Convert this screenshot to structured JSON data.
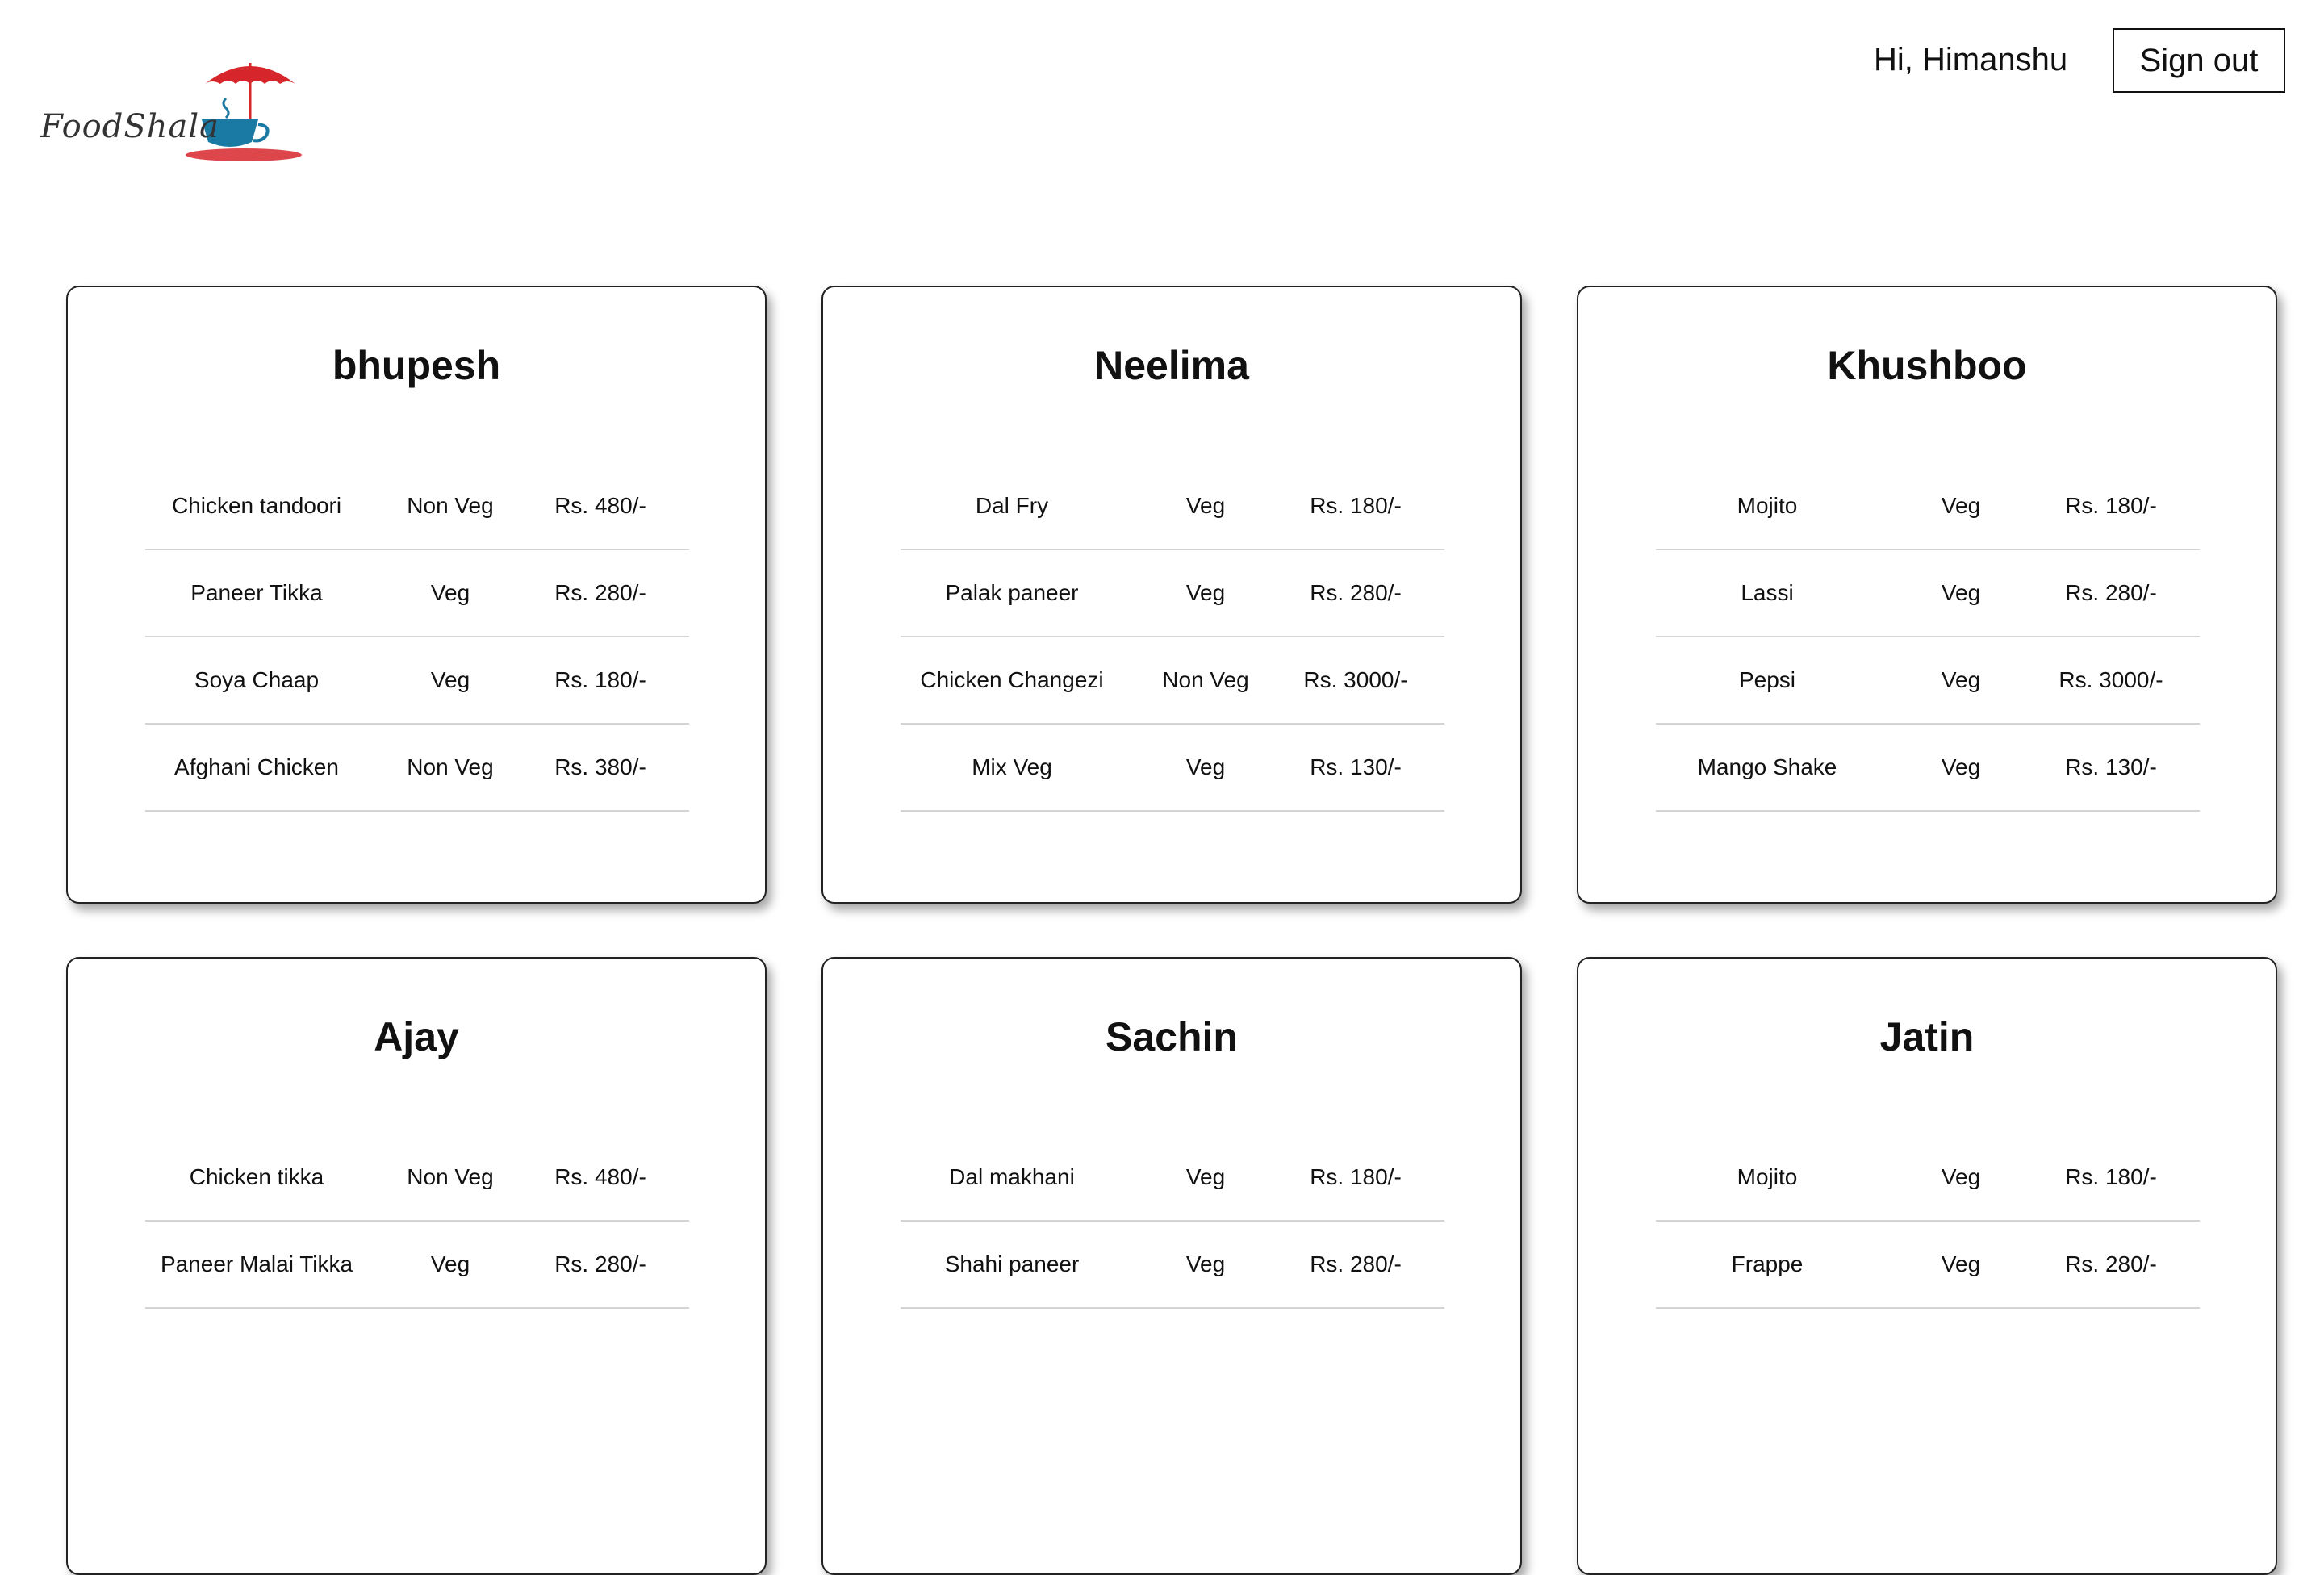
{
  "brand": {
    "name": "FoodShala",
    "colors": {
      "umbrella": "#d7262b",
      "cup": "#1b7aa3",
      "text": "#333333"
    }
  },
  "header": {
    "greeting": "Hi, Himanshu",
    "signout_label": "Sign out"
  },
  "restaurants": [
    {
      "name": "bhupesh",
      "items": [
        {
          "name": "Chicken tandoori",
          "type": "Non Veg",
          "price": "Rs. 480/-"
        },
        {
          "name": "Paneer Tikka",
          "type": "Veg",
          "price": "Rs. 280/-"
        },
        {
          "name": "Soya Chaap",
          "type": "Veg",
          "price": "Rs. 180/-"
        },
        {
          "name": "Afghani Chicken",
          "type": "Non Veg",
          "price": "Rs. 380/-"
        }
      ]
    },
    {
      "name": "Neelima",
      "items": [
        {
          "name": "Dal Fry",
          "type": "Veg",
          "price": "Rs. 180/-"
        },
        {
          "name": "Palak paneer",
          "type": "Veg",
          "price": "Rs. 280/-"
        },
        {
          "name": "Chicken Changezi",
          "type": "Non Veg",
          "price": "Rs. 3000/-"
        },
        {
          "name": "Mix Veg",
          "type": "Veg",
          "price": "Rs. 130/-"
        }
      ]
    },
    {
      "name": "Khushboo",
      "items": [
        {
          "name": "Mojito",
          "type": "Veg",
          "price": "Rs. 180/-"
        },
        {
          "name": "Lassi",
          "type": "Veg",
          "price": "Rs. 280/-"
        },
        {
          "name": "Pepsi",
          "type": "Veg",
          "price": "Rs. 3000/-"
        },
        {
          "name": "Mango Shake",
          "type": "Veg",
          "price": "Rs. 130/-"
        }
      ]
    },
    {
      "name": "Ajay",
      "items": [
        {
          "name": "Chicken tikka",
          "type": "Non Veg",
          "price": "Rs. 480/-"
        },
        {
          "name": "Paneer Malai Tikka",
          "type": "Veg",
          "price": "Rs. 280/-"
        }
      ]
    },
    {
      "name": "Sachin",
      "items": [
        {
          "name": "Dal makhani",
          "type": "Veg",
          "price": "Rs. 180/-"
        },
        {
          "name": "Shahi paneer",
          "type": "Veg",
          "price": "Rs. 280/-"
        }
      ]
    },
    {
      "name": "Jatin",
      "items": [
        {
          "name": "Mojito",
          "type": "Veg",
          "price": "Rs. 180/-"
        },
        {
          "name": "Frappe",
          "type": "Veg",
          "price": "Rs. 280/-"
        }
      ]
    }
  ]
}
